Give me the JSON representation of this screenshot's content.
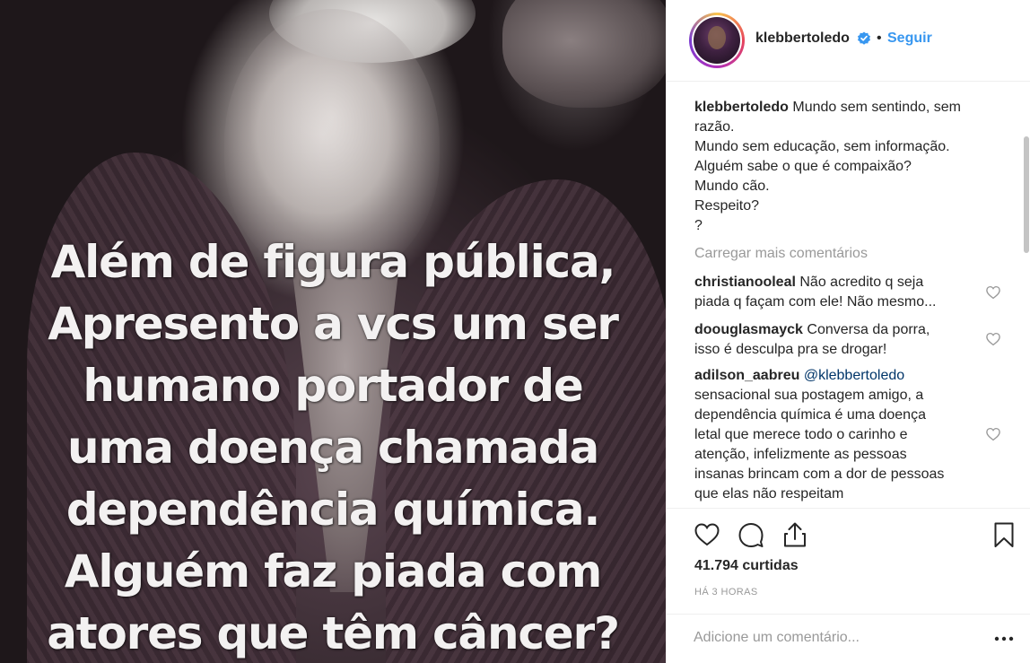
{
  "post_image": {
    "overlay_lines": [
      "Além de figura pública,",
      "Apresento a vcs um ser",
      "humano portador de",
      "uma doença chamada",
      "dependência química.",
      "Alguém faz piada com",
      "atores que têm câncer?"
    ]
  },
  "header": {
    "username": "klebbertoledo",
    "separator": "•",
    "follow_label": "Seguir",
    "avatar_icon": "profile-avatar",
    "verified_icon": "verified-badge-icon"
  },
  "caption": {
    "username": "klebbertoledo",
    "first_line": "Mundo sem sentindo, sem",
    "lines": [
      "razão.",
      "Mundo sem educação, sem informação.",
      "Alguém sabe o que é compaixão?",
      "Mundo cão.",
      "Respeito?",
      "?"
    ]
  },
  "load_more_label": "Carregar mais comentários",
  "comments": [
    {
      "username": "christianooleal",
      "first_line": "Não acredito q seja",
      "lines": [
        "piada q façam com ele! Não mesmo..."
      ]
    },
    {
      "username": "doouglasmayck",
      "first_line": "Conversa da porra,",
      "lines": [
        "isso é desculpa pra se drogar!"
      ]
    },
    {
      "username": "adilson_aabreu",
      "mention": "@klebbertoledo",
      "lines": [
        "sensacional sua postagem amigo, a",
        "dependência química é uma doença",
        "letal que merece todo o carinho e",
        "atenção, infelizmente as pessoas",
        "insanas brincam com a dor de pessoas",
        "que elas não respeitam"
      ]
    }
  ],
  "actions": {
    "like_icon": "heart-icon",
    "comment_icon": "comment-icon",
    "share_icon": "share-icon",
    "save_icon": "bookmark-icon"
  },
  "likes_text": "41.794 curtidas",
  "time_text": "HÁ 3 HORAS",
  "add_comment": {
    "placeholder": "Adicione um comentário...",
    "more_icon": "more-options-icon"
  },
  "colors": {
    "link_blue": "#3897f0",
    "mention_blue": "#003569",
    "muted_gray": "#999999",
    "text": "#262626"
  }
}
